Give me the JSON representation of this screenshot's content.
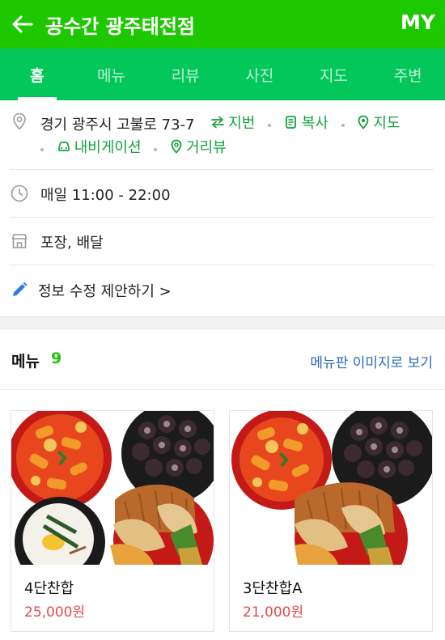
{
  "header": {
    "title": "공수간 광주태전점",
    "my_label": "MY"
  },
  "tabs": [
    {
      "label": "홈",
      "active": true
    },
    {
      "label": "메뉴",
      "active": false
    },
    {
      "label": "리뷰",
      "active": false
    },
    {
      "label": "사진",
      "active": false
    },
    {
      "label": "지도",
      "active": false
    },
    {
      "label": "주변",
      "active": false
    }
  ],
  "info": {
    "address": "경기 광주시 고불로 73-7",
    "address_actions": {
      "lot_number": "지번",
      "copy": "복사",
      "map": "지도",
      "navigation": "내비게이션",
      "street_view": "거리뷰"
    },
    "hours": "매일 11:00 - 22:00",
    "service": "포장, 배달",
    "suggest_edit": "정보 수정 제안하기 >"
  },
  "menu": {
    "title": "메뉴",
    "count": "9",
    "view_board": "메뉴판 이미지로 보기",
    "items": [
      {
        "name": "4단찬합",
        "price": "25,000원"
      },
      {
        "name": "3단찬합A",
        "price": "21,000원"
      }
    ]
  },
  "colors": {
    "header_green": "#1ec800",
    "tab_green": "#03c75a",
    "action_green": "#14a33c",
    "price_red": "#e24b4b",
    "link_blue": "#2b6bb8"
  }
}
